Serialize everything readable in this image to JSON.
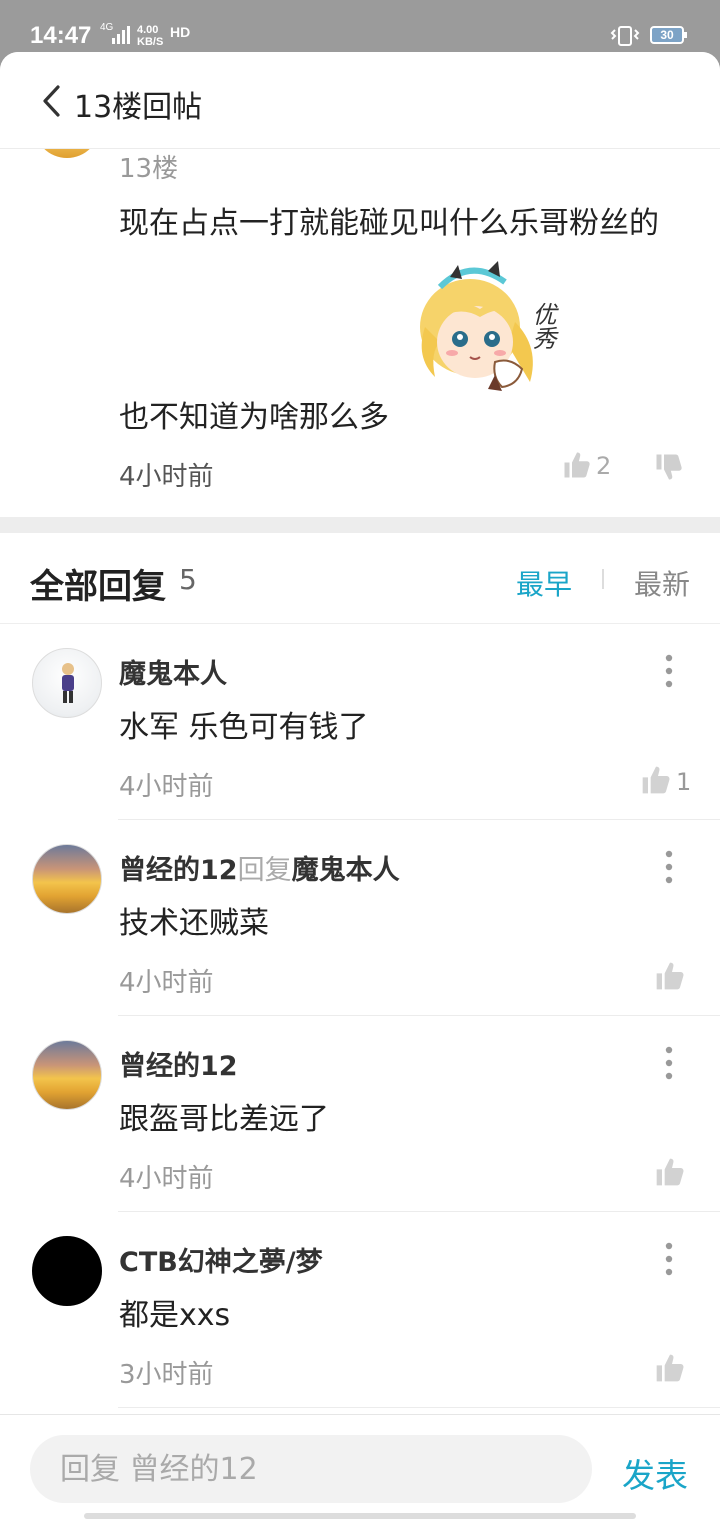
{
  "status_bar": {
    "time": "14:47",
    "network": "4G",
    "speed": "4.00",
    "speed_unit": "KB/S",
    "hd": "HD",
    "battery": "30"
  },
  "header": {
    "title": "13楼回帖",
    "back_icon": "chevron-left-icon"
  },
  "post": {
    "floor": "13楼",
    "text_line1": "现在占点一打就能碰见叫什么乐哥粉丝的",
    "sticker_text": "优秀",
    "text_line2": "也不知道为啥那么多",
    "time": "4小时前",
    "likes": "2"
  },
  "replies_header": {
    "title": "全部回复",
    "count": "5",
    "sort_earliest": "最早",
    "sort_latest": "最新",
    "accent_color": "#1aa5c8"
  },
  "replies": [
    {
      "name": "魔鬼本人",
      "reply_word": "",
      "reply_to": "",
      "text": "水军 乐色可有钱了",
      "time": "4小时前",
      "likes": "1"
    },
    {
      "name": "曾经的12",
      "reply_word": "回复",
      "reply_to": "魔鬼本人",
      "text": "技术还贼菜",
      "time": "4小时前",
      "likes": ""
    },
    {
      "name": "曾经的12",
      "reply_word": "",
      "reply_to": "",
      "text": "跟盔哥比差远了",
      "time": "4小时前",
      "likes": ""
    },
    {
      "name": "CTB幻神之夢/梦",
      "reply_word": "",
      "reply_to": "",
      "text": "都是xxs",
      "time": "3小时前",
      "likes": ""
    }
  ],
  "compose": {
    "placeholder": "回复 曾经的12",
    "send_label": "发表"
  }
}
